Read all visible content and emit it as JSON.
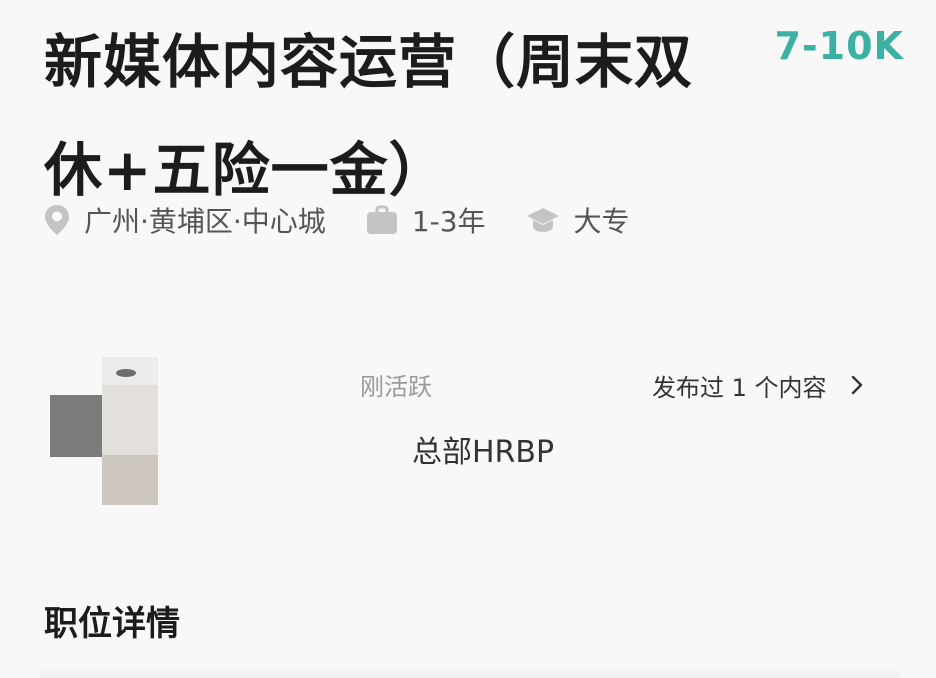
{
  "job": {
    "title": "新媒体内容运营（周末双休+五险一金）",
    "salary": "7-10K"
  },
  "meta": {
    "location": "广州·黄埔区·中心城",
    "experience": "1-3年",
    "education": "大专"
  },
  "recruiter": {
    "status": "刚活跃",
    "role": "总部HRBP",
    "posts_label": "发布过 1 个内容"
  },
  "section": {
    "title": "职位详情"
  },
  "colors": {
    "salary": "#3bb1a3",
    "icon": "#c4c4c4"
  }
}
